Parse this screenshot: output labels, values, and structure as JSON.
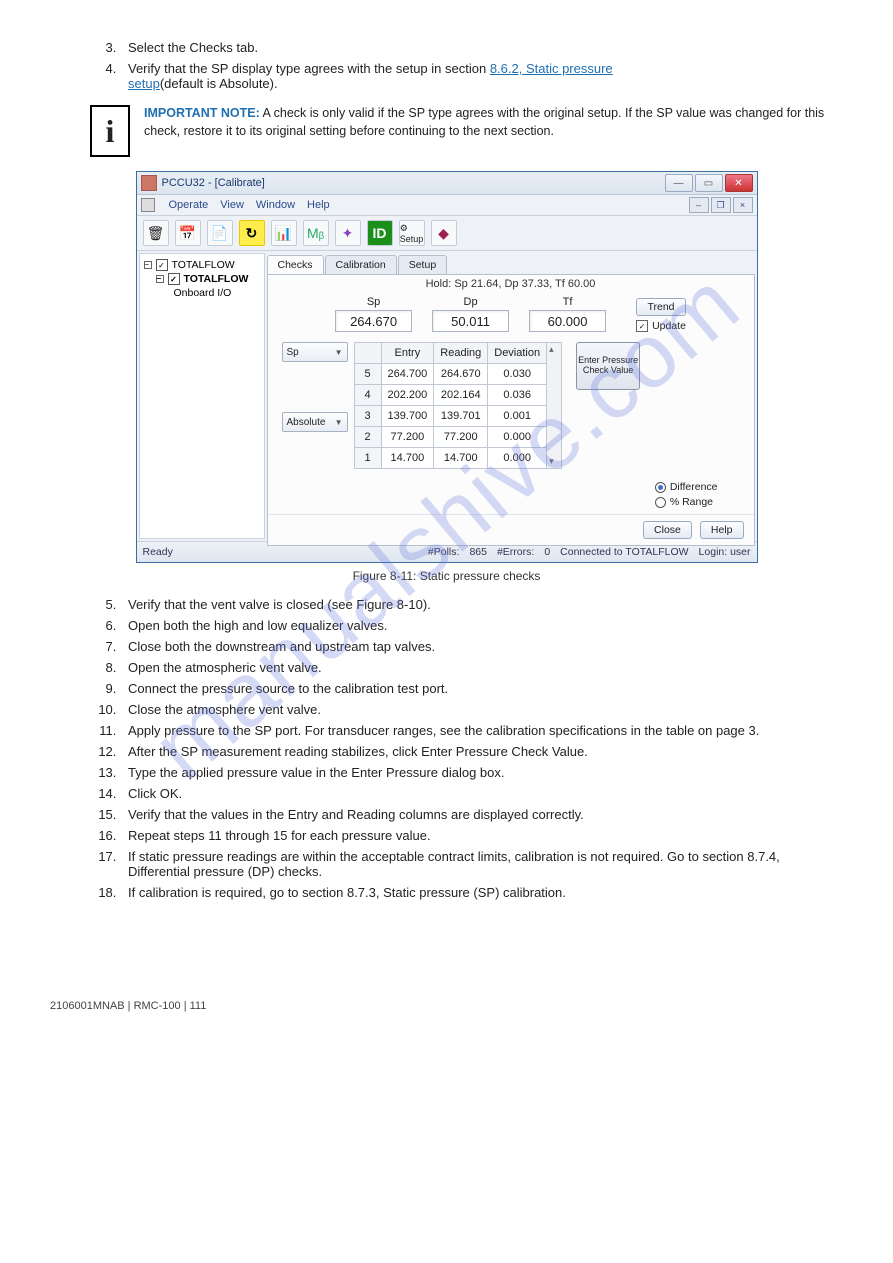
{
  "steps_top": [
    {
      "n": "3.",
      "t": "Select the Checks tab."
    },
    {
      "n": "4.",
      "pre": "Verify that the SP display type agrees with the setup in section ",
      "link": "8.6.2, Static pressure ",
      "post": "(default is Absolute)."
    }
  ],
  "info_link_text": "setup",
  "info": {
    "header": "IMPORTANT NOTE:",
    "body": " A check is only valid if the SP type agrees with the original setup. If the SP value was changed for this check, restore it to its original setting before continuing to the next section."
  },
  "fig_caption": "Figure 8-11: Static pressure checks",
  "win": {
    "title": "PCCU32 - [Calibrate]",
    "menus": [
      "Operate",
      "View",
      "Window",
      "Help"
    ],
    "tree": [
      {
        "txt": "TOTALFLOW",
        "chk": true,
        "cls": ""
      },
      {
        "txt": "TOTALFLOW",
        "chk": true,
        "cls": "indent1 bold"
      },
      {
        "txt": "Onboard I/O",
        "chk": false,
        "cls": "indent2"
      }
    ],
    "tabs": [
      "Checks",
      "Calibration",
      "Setup"
    ],
    "hold": "Hold: Sp 21.64, Dp 37.33, Tf 60.00",
    "vals": [
      {
        "lbl": "Sp",
        "v": "264.670"
      },
      {
        "lbl": "Dp",
        "v": "50.011"
      },
      {
        "lbl": "Tf",
        "v": "60.000"
      }
    ],
    "trend": "Trend",
    "update": "Update",
    "combo1": "Sp",
    "combo2": "Absolute",
    "cols": [
      "Entry",
      "Reading",
      "Deviation"
    ],
    "rows": [
      [
        "5",
        "264.700",
        "264.670",
        "0.030"
      ],
      [
        "4",
        "202.200",
        "202.164",
        "0.036"
      ],
      [
        "3",
        "139.700",
        "139.701",
        "0.001"
      ],
      [
        "2",
        "77.200",
        "77.200",
        "0.000"
      ],
      [
        "1",
        "14.700",
        "14.700",
        "0.000"
      ]
    ],
    "enter": "Enter Pressure Check Value",
    "radios": [
      "Difference",
      "% Range"
    ],
    "close": "Close",
    "help": "Help",
    "status": {
      "ready": "Ready",
      "polls_l": "#Polls:",
      "polls_v": "865",
      "err_l": "#Errors:",
      "err_v": "0",
      "conn": "Connected to TOTALFLOW",
      "login": "Login: user"
    }
  },
  "steps_mid": [
    {
      "n": "5.",
      "t": "Verify that the vent valve is closed (see Figure 8-10)."
    },
    {
      "n": "6.",
      "t": "Open both the high and low equalizer valves."
    },
    {
      "n": "7.",
      "t": "Close both the downstream and upstream tap valves."
    },
    {
      "n": "8.",
      "t": "Open the atmospheric vent valve."
    },
    {
      "n": "9.",
      "t": "Connect the pressure source to the calibration test port."
    },
    {
      "n": "10.",
      "t": "Close the atmosphere vent valve."
    },
    {
      "n": "11.",
      "t": "Apply pressure to the SP port. For transducer ranges, see the calibration specifications in the table on page 3."
    },
    {
      "n": "12.",
      "t": "After the SP measurement reading stabilizes, click Enter Pressure Check Value."
    },
    {
      "n": "13.",
      "t": "Type the applied pressure value in the Enter Pressure dialog box."
    },
    {
      "n": "14.",
      "t": "Click OK."
    },
    {
      "n": "15.",
      "t": "Verify that the values in the Entry and Reading columns are displayed correctly."
    },
    {
      "n": "16.",
      "t": "Repeat steps 11 through 15 for each pressure value."
    },
    {
      "n": "17.",
      "t": "If static pressure readings are within the acceptable contract limits, calibration is not required. Go to section 8.7.4, Differential pressure (DP) checks."
    },
    {
      "n": "18.",
      "t": "If calibration is required, go to section 8.7.3, Static pressure (SP) calibration."
    }
  ],
  "footer": {
    "left": "2106001MNAB | RMC-100 | 111",
    "right": ""
  }
}
